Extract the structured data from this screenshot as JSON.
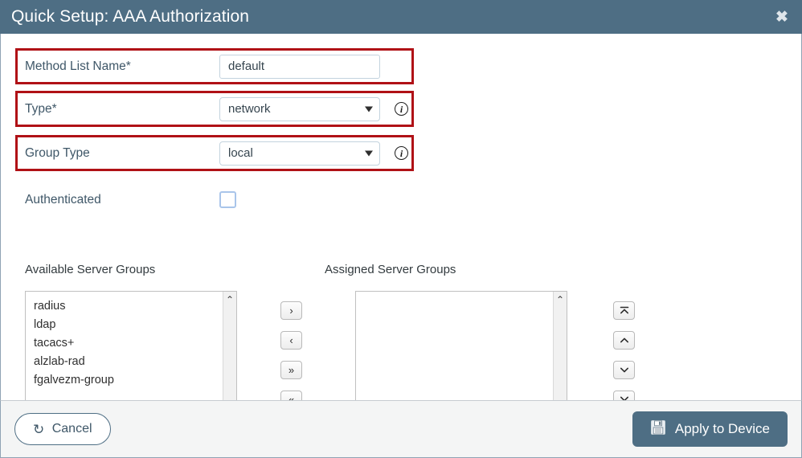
{
  "dialog": {
    "title": "Quick Setup: AAA Authorization",
    "close_label": "✖",
    "accent_header_color": "#4e6e84",
    "highlight_color": "#b01116"
  },
  "form": {
    "method_list_name": {
      "label": "Method List Name*",
      "value": "default",
      "placeholder": ""
    },
    "type": {
      "label": "Type*",
      "value": "network",
      "info_icon": "i",
      "options": [
        "network"
      ]
    },
    "group_type": {
      "label": "Group Type",
      "value": "local",
      "info_icon": "i",
      "options": [
        "local"
      ]
    },
    "authenticated": {
      "label": "Authenticated",
      "checked": false
    }
  },
  "transfer": {
    "available_label": "Available Server Groups",
    "assigned_label": "Assigned Server Groups",
    "available_items": [
      "radius",
      "ldap",
      "tacacs+",
      "alzlab-rad",
      "fgalvezm-group"
    ],
    "assigned_items": [],
    "buttons": {
      "move_right": "›",
      "move_left": "‹",
      "move_all_right": "»",
      "move_all_left": "«"
    },
    "order_buttons": {
      "move_top": "⤒",
      "move_up": "⌃",
      "move_down": "⌄",
      "move_bottom": "⤓"
    },
    "scroll_up": "⌃",
    "scroll_down": "⌄"
  },
  "footer": {
    "cancel_label": "Cancel",
    "cancel_icon": "↺",
    "apply_label": "Apply to Device",
    "apply_icon": "save-icon"
  }
}
